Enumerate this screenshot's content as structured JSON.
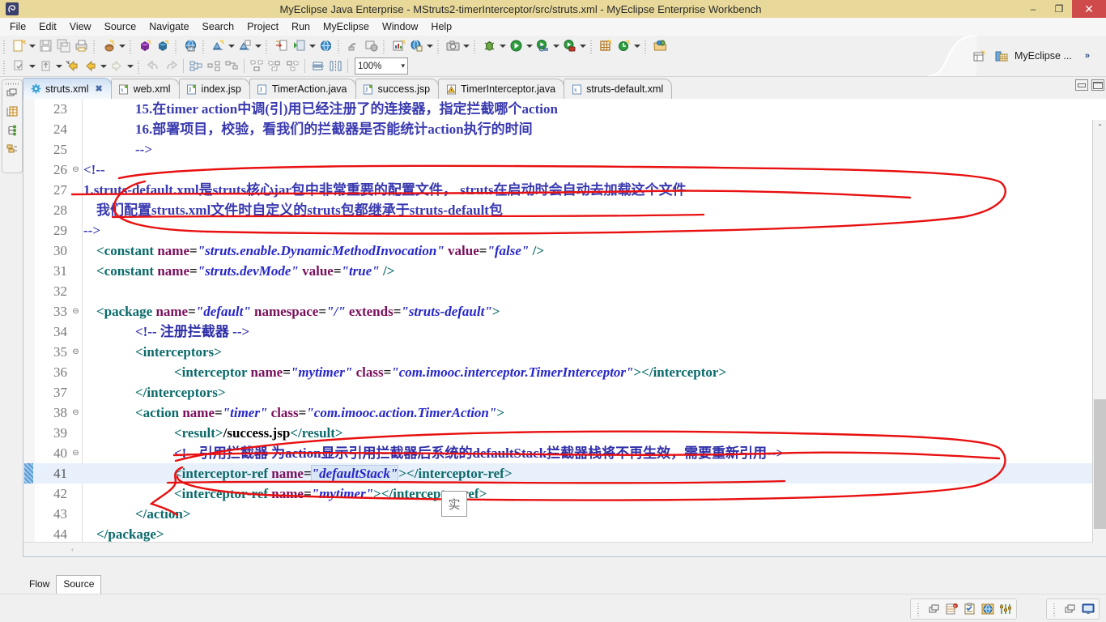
{
  "window": {
    "title": "MyEclipse Java Enterprise - MStruts2-timerInterceptor/src/struts.xml - MyEclipse Enterprise Workbench",
    "minimize_label": "–",
    "restore_label": "❐",
    "close_label": "✕",
    "titlebar_color": "#e8d99a",
    "close_color": "#cf4a4a"
  },
  "menubar": {
    "items": [
      {
        "label": "File",
        "mnemonic": "F"
      },
      {
        "label": "Edit",
        "mnemonic": "E"
      },
      {
        "label": "View",
        "mnemonic": "V"
      },
      {
        "label": "Source",
        "mnemonic": "S"
      },
      {
        "label": "Navigate",
        "mnemonic": "N"
      },
      {
        "label": "Search",
        "mnemonic": "a"
      },
      {
        "label": "Project",
        "mnemonic": "P"
      },
      {
        "label": "Run",
        "mnemonic": "R"
      },
      {
        "label": "MyEclipse",
        "mnemonic": ""
      },
      {
        "label": "Window",
        "mnemonic": "W"
      },
      {
        "label": "Help",
        "mnemonic": "H"
      }
    ]
  },
  "toolbar": {
    "zoom_value": "100%",
    "perspective_label": "MyEclipse ...",
    "overflow_label": "»",
    "row1_icons": [
      "new-wizard-icon",
      "save-icon",
      "save-all-icon",
      "print-icon",
      "new-java-package-icon",
      "new-class-icon",
      "new-interface-icon",
      "open-web-browser-icon",
      "new-xml-icon",
      "new-jsp-icon",
      "export-icon",
      "run-server-icon",
      "globe-icon",
      "globe2-icon",
      "deploy-icon",
      "web-deploy-icon",
      "chart-icon",
      "db-browser-icon",
      "screenshot-icon",
      "debug-icon",
      "run-icon",
      "run-history-icon",
      "run-external-icon",
      "grid-icon",
      "refresh-icon",
      "open-type-icon"
    ],
    "row2_icons": [
      "import-icon",
      "export2-icon",
      "back-icon",
      "back2-icon",
      "forward-icon",
      "undo-icon",
      "redo-icon",
      "next-annotation-icon",
      "prev-annotation-icon",
      "last-edit-icon",
      "outline1-icon",
      "outline2-icon",
      "outline3-icon",
      "align-icon",
      "distribute-icon"
    ],
    "right_icons": [
      "open-resource-icon",
      "pencil-icon",
      "open-folder-icon",
      "profile-icon",
      "script-icon"
    ]
  },
  "fastview": {
    "icons": [
      "restore-view-icon",
      "server-explorer-icon",
      "hierarchy-icon",
      "package-explorer-icon"
    ]
  },
  "editor": {
    "minimize_label": "",
    "maximize_label": "",
    "tabs": [
      {
        "label": "struts.xml",
        "icon": "xml-gear-icon",
        "active": true,
        "closeable": true
      },
      {
        "label": "web.xml",
        "icon": "xml-file-icon",
        "active": false,
        "closeable": false
      },
      {
        "label": "index.jsp",
        "icon": "jsp-file-icon",
        "active": false,
        "closeable": false
      },
      {
        "label": "TimerAction.java",
        "icon": "java-file-icon",
        "active": false,
        "closeable": false
      },
      {
        "label": "success.jsp",
        "icon": "jsp-file-icon",
        "active": false,
        "closeable": false
      },
      {
        "label": "TimerInterceptor.java",
        "icon": "java-warn-icon",
        "active": false,
        "closeable": false
      },
      {
        "label": "struts-default.xml",
        "icon": "xml-file-icon",
        "active": false,
        "closeable": false
      }
    ],
    "close_glyph": "✖",
    "page_tabs": [
      {
        "label": "Flow",
        "active": false
      },
      {
        "label": "Source",
        "active": true
      }
    ],
    "scroll": {
      "up_glyph": "⌃",
      "down_glyph": "⌄",
      "left_glyph": "‹"
    }
  },
  "code": {
    "highlighted_line": 41,
    "caret_line": 41,
    "ime_candidate": "实",
    "lines": [
      {
        "num": "23",
        "fold": "",
        "indent": 4,
        "segments": [
          {
            "cls": "k-cmtz",
            "text": "15.在timer action中调(引)用已经注册了的连接器，指定拦截哪个action"
          }
        ]
      },
      {
        "num": "24",
        "fold": "",
        "indent": 4,
        "segments": [
          {
            "cls": "k-cmtz",
            "text": "16.部署项目，校验，看我们的拦截器是否能统计action执行的时间"
          }
        ]
      },
      {
        "num": "25",
        "fold": "",
        "indent": 4,
        "segments": [
          {
            "cls": "k-cmtz",
            "text": "-->"
          }
        ]
      },
      {
        "num": "26",
        "fold": "⊖",
        "indent": 0,
        "segments": [
          {
            "cls": "k-cmtz",
            "text": "<!--"
          }
        ]
      },
      {
        "num": "27",
        "fold": "",
        "indent": 0,
        "segments": [
          {
            "cls": "k-cmtz",
            "text": "1.struts-default.xml是struts核心jar包中非常重要的配置文件， struts在启动时会自动去加载这个文件"
          }
        ]
      },
      {
        "num": "28",
        "fold": "",
        "indent": 1,
        "segments": [
          {
            "cls": "k-cmtz",
            "text": "我们配置struts.xml文件时自定义的struts包都继承于struts-default包"
          }
        ]
      },
      {
        "num": "29",
        "fold": "",
        "indent": 0,
        "segments": [
          {
            "cls": "k-cmtz",
            "text": "-->"
          }
        ]
      },
      {
        "num": "30",
        "fold": "",
        "indent": 1,
        "segments": [
          {
            "cls": "k-tag",
            "text": "<constant "
          },
          {
            "cls": "k-attr",
            "text": "name"
          },
          {
            "cls": "k-plain",
            "text": "="
          },
          {
            "cls": "k-val",
            "text": "\"struts.enable.DynamicMethodInvocation\""
          },
          {
            "cls": "k-attr",
            "text": " value"
          },
          {
            "cls": "k-plain",
            "text": "="
          },
          {
            "cls": "k-val",
            "text": "\"false\""
          },
          {
            "cls": "k-tag",
            "text": " />"
          }
        ]
      },
      {
        "num": "31",
        "fold": "",
        "indent": 1,
        "segments": [
          {
            "cls": "k-tag",
            "text": "<constant "
          },
          {
            "cls": "k-attr",
            "text": "name"
          },
          {
            "cls": "k-plain",
            "text": "="
          },
          {
            "cls": "k-val",
            "text": "\"struts.devMode\""
          },
          {
            "cls": "k-attr",
            "text": " value"
          },
          {
            "cls": "k-plain",
            "text": "="
          },
          {
            "cls": "k-val",
            "text": "\"true\""
          },
          {
            "cls": "k-tag",
            "text": " />"
          }
        ]
      },
      {
        "num": "32",
        "fold": "",
        "indent": 0,
        "segments": []
      },
      {
        "num": "33",
        "fold": "⊖",
        "indent": 1,
        "segments": [
          {
            "cls": "k-tag",
            "text": "<package "
          },
          {
            "cls": "k-attr",
            "text": "name"
          },
          {
            "cls": "k-plain",
            "text": "="
          },
          {
            "cls": "k-val",
            "text": "\"default\""
          },
          {
            "cls": "k-attr",
            "text": " namespace"
          },
          {
            "cls": "k-plain",
            "text": "="
          },
          {
            "cls": "k-val",
            "text": "\"/\""
          },
          {
            "cls": "k-attr",
            "text": " extends"
          },
          {
            "cls": "k-plain",
            "text": "="
          },
          {
            "cls": "k-val",
            "text": "\"struts-default\""
          },
          {
            "cls": "k-tag",
            "text": ">"
          }
        ]
      },
      {
        "num": "34",
        "fold": "",
        "indent": 4,
        "segments": [
          {
            "cls": "k-cmt",
            "text": "<!-- 注册拦截器 -->"
          }
        ]
      },
      {
        "num": "35",
        "fold": "⊖",
        "indent": 4,
        "segments": [
          {
            "cls": "k-tag",
            "text": "<interceptors>"
          }
        ]
      },
      {
        "num": "36",
        "fold": "",
        "indent": 7,
        "segments": [
          {
            "cls": "k-tag",
            "text": "<interceptor "
          },
          {
            "cls": "k-attr",
            "text": "name"
          },
          {
            "cls": "k-plain",
            "text": "="
          },
          {
            "cls": "k-val",
            "text": "\"mytimer\""
          },
          {
            "cls": "k-attr",
            "text": " class"
          },
          {
            "cls": "k-plain",
            "text": "="
          },
          {
            "cls": "k-val",
            "text": "\"com.imooc.interceptor.TimerInterceptor\""
          },
          {
            "cls": "k-tag",
            "text": "></interceptor>"
          }
        ]
      },
      {
        "num": "37",
        "fold": "",
        "indent": 4,
        "segments": [
          {
            "cls": "k-tag",
            "text": "</interceptors>"
          }
        ]
      },
      {
        "num": "38",
        "fold": "⊖",
        "indent": 4,
        "segments": [
          {
            "cls": "k-tag",
            "text": "<action "
          },
          {
            "cls": "k-attr",
            "text": "name"
          },
          {
            "cls": "k-plain",
            "text": "="
          },
          {
            "cls": "k-val",
            "text": "\"timer\""
          },
          {
            "cls": "k-attr",
            "text": " class"
          },
          {
            "cls": "k-plain",
            "text": "="
          },
          {
            "cls": "k-val",
            "text": "\"com.imooc.action.TimerAction\""
          },
          {
            "cls": "k-tag",
            "text": ">"
          }
        ]
      },
      {
        "num": "39",
        "fold": "",
        "indent": 7,
        "segments": [
          {
            "cls": "k-tag",
            "text": "<result>"
          },
          {
            "cls": "k-txt",
            "text": "/success.jsp"
          },
          {
            "cls": "k-tag",
            "text": "</result>"
          }
        ]
      },
      {
        "num": "40",
        "fold": "⊖",
        "indent": 7,
        "segments": [
          {
            "cls": "k-cmt",
            "text": "<!-- 引用拦截器 为action显示引用拦截器后系统的defaultStack拦截器栈将不再生效，需要重新引用-->"
          }
        ]
      },
      {
        "num": "41",
        "fold": "",
        "indent": 7,
        "segments": [
          {
            "cls": "k-tag",
            "text": "<interceptor-ref "
          },
          {
            "cls": "k-attr",
            "text": "name"
          },
          {
            "cls": "k-plain",
            "text": "="
          },
          {
            "cls": "k-sel",
            "text": "\"defaultStack\""
          },
          {
            "cls": "k-tag",
            "text": "></interceptor-ref>"
          }
        ]
      },
      {
        "num": "42",
        "fold": "",
        "indent": 7,
        "segments": [
          {
            "cls": "k-tag",
            "text": "<interceptor-ref "
          },
          {
            "cls": "k-attr",
            "text": "name"
          },
          {
            "cls": "k-plain",
            "text": "="
          },
          {
            "cls": "k-val",
            "text": "\"mytimer\""
          },
          {
            "cls": "k-tag",
            "text": "></interceptor-ref>"
          }
        ]
      },
      {
        "num": "43",
        "fold": "",
        "indent": 4,
        "segments": [
          {
            "cls": "k-tag",
            "text": "</action>"
          }
        ]
      },
      {
        "num": "44",
        "fold": "",
        "indent": 1,
        "segments": [
          {
            "cls": "k-tag",
            "text": "</package>"
          }
        ]
      },
      {
        "num": "45",
        "fold": "",
        "indent": 0,
        "segments": []
      }
    ]
  },
  "annotations": {
    "ink_color": "#e81010",
    "shapes": [
      "ellipse-lines-27-29",
      "strike-line-27",
      "ellipse-lines-40-42",
      "brace-lines-41-42"
    ]
  },
  "statusbar": {
    "left_group_icons": [
      "restore-icon",
      "xml-error-icon",
      "tasks-icon",
      "browser-icon",
      "filters-icon"
    ],
    "right_group_icons": [
      "restore-icon",
      "console-icon"
    ]
  }
}
